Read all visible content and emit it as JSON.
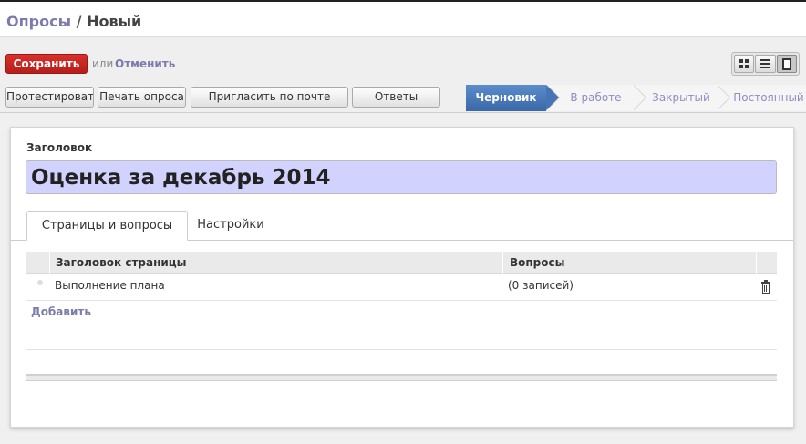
{
  "breadcrumb": {
    "parent": "Опросы",
    "separator": "/",
    "current": "Новый"
  },
  "buttons": {
    "save": "Сохранить",
    "or_text": "или",
    "cancel": "Отменить"
  },
  "view_modes": [
    {
      "name": "kanban",
      "icon": "kanban-icon",
      "active": false
    },
    {
      "name": "list",
      "icon": "list-icon",
      "active": false
    },
    {
      "name": "form",
      "icon": "form-icon",
      "active": true
    }
  ],
  "actions": {
    "test": "Протестировать",
    "print": "Печать опроса",
    "invite": "Пригласить по почте",
    "answers": "Ответы"
  },
  "stages": [
    {
      "label": "Черновик",
      "active": true
    },
    {
      "label": "В работе",
      "active": false
    },
    {
      "label": "Закрытый",
      "active": false
    },
    {
      "label": "Постоянный",
      "active": false
    }
  ],
  "form": {
    "title_label": "Заголовок",
    "title_value": "Оценка за декабрь 2014",
    "tabs": [
      {
        "label": "Страницы и вопросы",
        "active": true
      },
      {
        "label": "Настройки",
        "active": false
      }
    ],
    "grid": {
      "columns": [
        "Заголовок страницы",
        "Вопросы"
      ],
      "rows": [
        {
          "page_title": "Выполнение плана",
          "questions": "(0 записей)"
        }
      ],
      "add_label": "Добавить"
    }
  },
  "colors": {
    "link": "#7c7bad",
    "save_button": "#c9241f",
    "active_stage": "#4774b4",
    "title_input_bg": "#d2d2ff"
  }
}
